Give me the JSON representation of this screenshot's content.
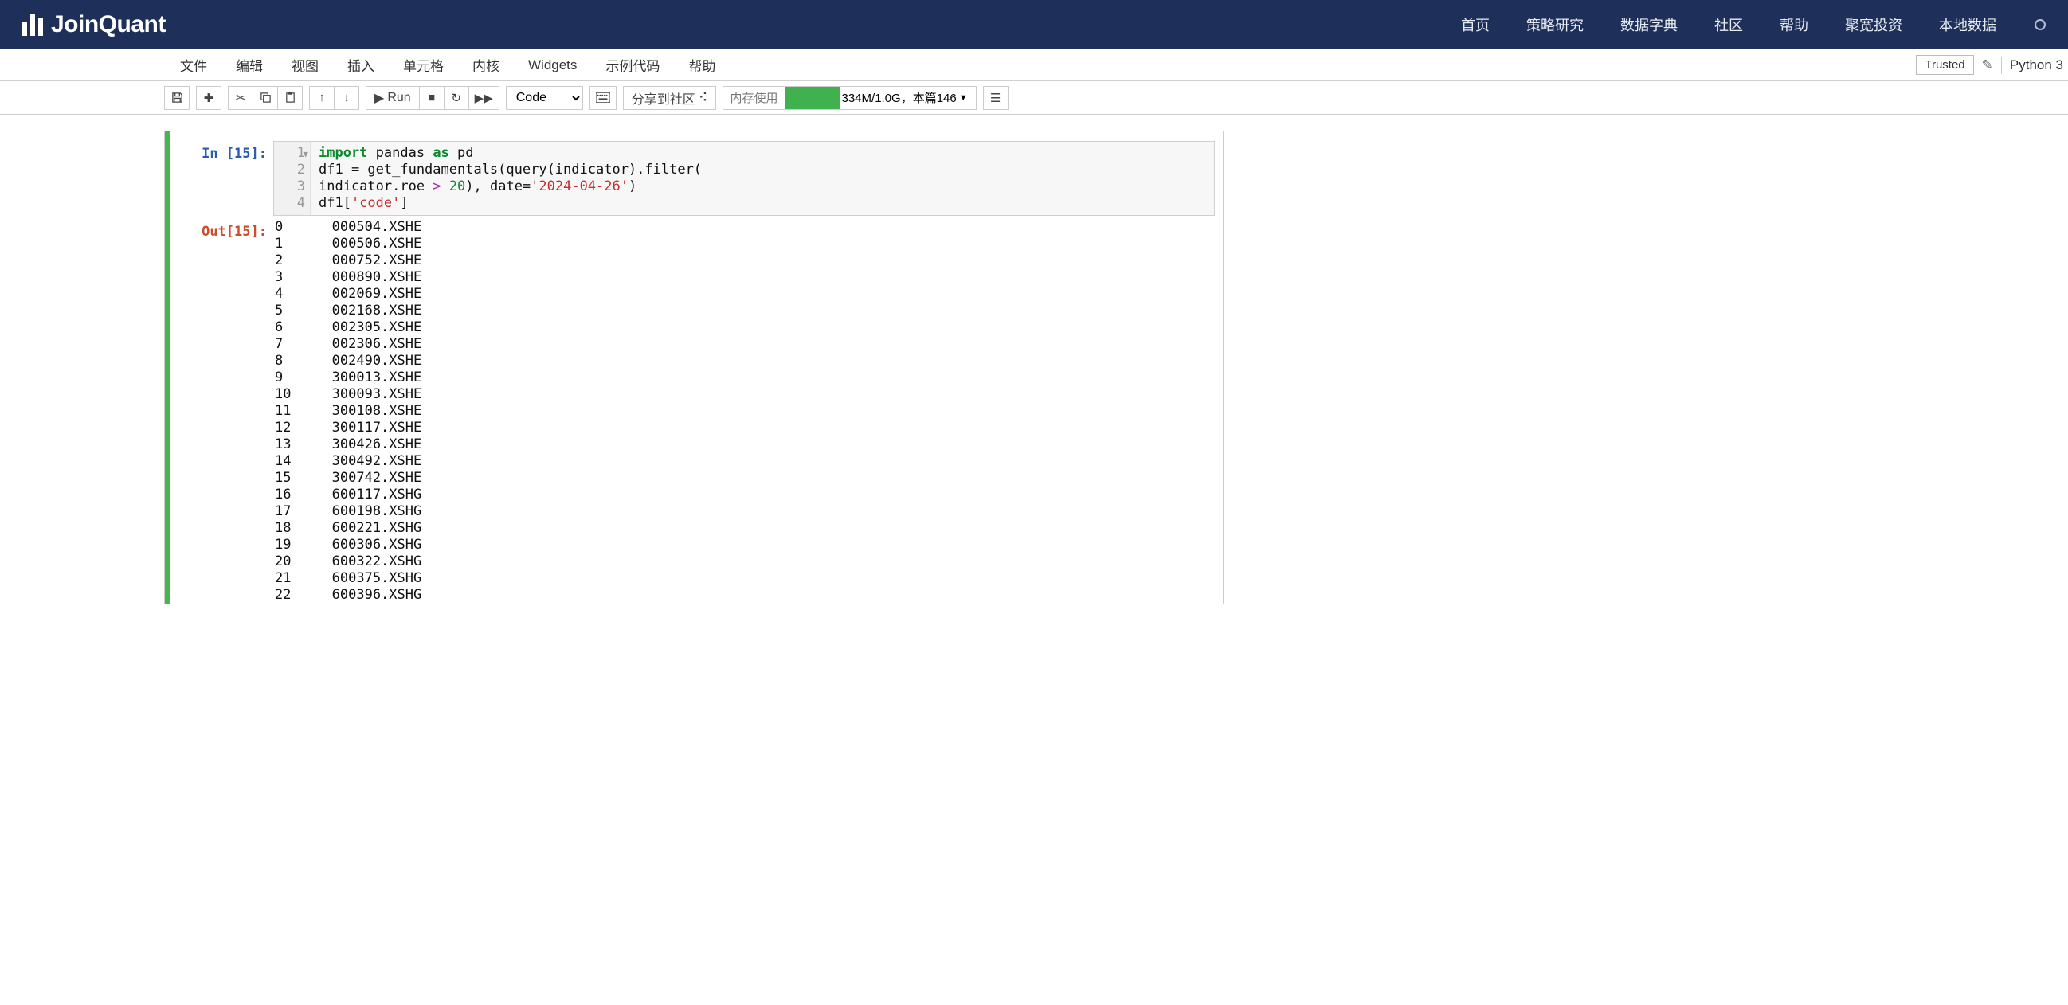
{
  "header": {
    "logo_text": "JoinQuant",
    "nav": [
      "首页",
      "策略研究",
      "数据字典",
      "社区",
      "帮助",
      "聚宽投资",
      "本地数据"
    ]
  },
  "menubar": {
    "items": [
      "文件",
      "编辑",
      "视图",
      "插入",
      "单元格",
      "内核",
      "Widgets",
      "示例代码",
      "帮助"
    ],
    "trusted": "Trusted",
    "kernel": "Python 3"
  },
  "toolbar": {
    "run_label": "Run",
    "cell_type": "Code",
    "share_label": "分享到社区",
    "memory_label": "内存使用",
    "memory_text": "334M/1.0G，本篇146"
  },
  "cell": {
    "in_prompt": "In [15]:",
    "out_prompt": "Out[15]:",
    "line_numbers": [
      "1",
      "2",
      "3",
      "4"
    ],
    "code": {
      "l1": {
        "import": "import",
        "pandas": " pandas ",
        "as": "as",
        "pd": " pd"
      },
      "l2_pre": "df1 = get_fundamentals(query(indicator).filter(",
      "l3_pre": "indicator.roe ",
      "l3_op": ">",
      "l3_sp": " ",
      "l3_num": "20",
      "l3_mid": "), date=",
      "l3_str": "'2024-04-26'",
      "l3_close": ")",
      "l4_pre": "df1[",
      "l4_str": "'code'",
      "l4_close": "]"
    },
    "output_rows": [
      {
        "idx": "0",
        "val": "000504.XSHE"
      },
      {
        "idx": "1",
        "val": "000506.XSHE"
      },
      {
        "idx": "2",
        "val": "000752.XSHE"
      },
      {
        "idx": "3",
        "val": "000890.XSHE"
      },
      {
        "idx": "4",
        "val": "002069.XSHE"
      },
      {
        "idx": "5",
        "val": "002168.XSHE"
      },
      {
        "idx": "6",
        "val": "002305.XSHE"
      },
      {
        "idx": "7",
        "val": "002306.XSHE"
      },
      {
        "idx": "8",
        "val": "002490.XSHE"
      },
      {
        "idx": "9",
        "val": "300013.XSHE"
      },
      {
        "idx": "10",
        "val": "300093.XSHE"
      },
      {
        "idx": "11",
        "val": "300108.XSHE"
      },
      {
        "idx": "12",
        "val": "300117.XSHE"
      },
      {
        "idx": "13",
        "val": "300426.XSHE"
      },
      {
        "idx": "14",
        "val": "300492.XSHE"
      },
      {
        "idx": "15",
        "val": "300742.XSHE"
      },
      {
        "idx": "16",
        "val": "600117.XSHG"
      },
      {
        "idx": "17",
        "val": "600198.XSHG"
      },
      {
        "idx": "18",
        "val": "600221.XSHG"
      },
      {
        "idx": "19",
        "val": "600306.XSHG"
      },
      {
        "idx": "20",
        "val": "600322.XSHG"
      },
      {
        "idx": "21",
        "val": "600375.XSHG"
      },
      {
        "idx": "22",
        "val": "600396.XSHG"
      }
    ]
  }
}
